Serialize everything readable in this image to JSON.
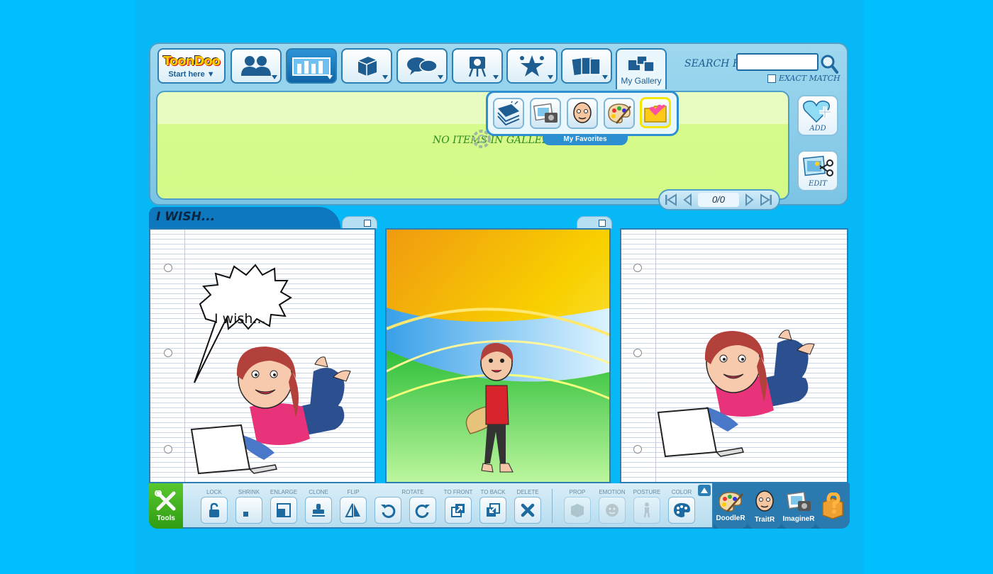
{
  "toolbar": {
    "logo": "ToonDoo",
    "start_here": "Start here",
    "gallery_label": "My Gallery",
    "search_label": "SEARCH FOR",
    "search_value": "",
    "exact_match": "EXACT MATCH"
  },
  "gallery": {
    "empty_message": "NO ITEMS IN GALLERY YET",
    "add_label": "ADD",
    "edit_label": "EDIT",
    "pager_count": "0/0"
  },
  "favorites": {
    "label": "My Favorites"
  },
  "comic": {
    "title": "I WISH...",
    "speech": "I wish..."
  },
  "tools": {
    "tab_label": "Tools",
    "lock": "LOCK",
    "shrink": "SHRINK",
    "enlarge": "ENLARGE",
    "clone": "CLONE",
    "flip": "FLIP",
    "rotate": "ROTATE",
    "to_front": "TO FRONT",
    "to_back": "TO BACK",
    "delete": "DELETE",
    "prop": "PROP",
    "emotion": "EMOTION",
    "posture": "POSTURE",
    "color": "COLOR"
  },
  "apps": {
    "doodler": "DoodleR",
    "traitr": "TraitR",
    "imaginer": "ImagineR"
  }
}
